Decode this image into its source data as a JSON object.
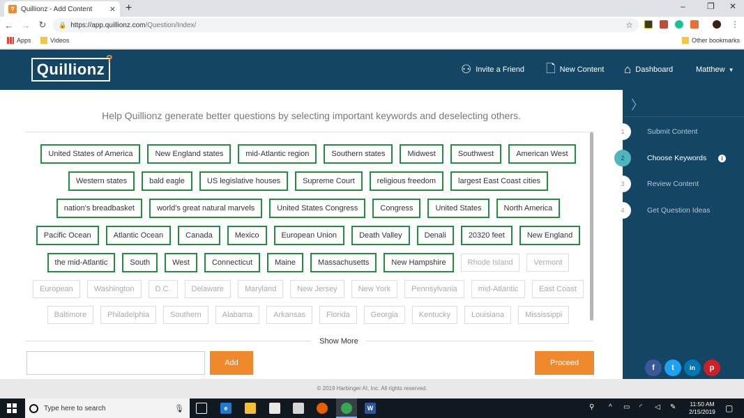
{
  "browser": {
    "tab_title": "Quillionz - Add Content",
    "tab_favicon": "?",
    "url_host": "https://app.quillionz.com",
    "url_path": "/Question/Index/",
    "bookmarks": [
      "Apps",
      "Videos"
    ],
    "other_bookmarks": "Other bookmarks"
  },
  "header": {
    "logo": "Quillionz",
    "logo_mark": "?",
    "invite": "Invite a Friend",
    "new_content": "New Content",
    "dashboard": "Dashboard",
    "user": "Matthew"
  },
  "main": {
    "instruction": "Help Quillionz generate better questions by selecting important keywords and deselecting others.",
    "show_more": "Show More",
    "add_label": "Add",
    "proceed_label": "Proceed"
  },
  "keywords": {
    "row1": [
      "United States of America",
      "New England states",
      "mid-Atlantic region",
      "Southern states",
      "Midwest",
      "Southwest",
      "American West"
    ],
    "row2": [
      "Western states",
      "bald eagle",
      "US legislative houses",
      "Supreme Court",
      "religious freedom",
      "largest East Coast cities"
    ],
    "row3": [
      "nation's breadbasket",
      "world's great natural marvels",
      "United States Congress",
      "Congress",
      "United States",
      "North America"
    ],
    "row4": [
      "Pacific Ocean",
      "Atlantic Ocean",
      "Canada",
      "Mexico",
      "European Union",
      "Death Valley",
      "Denali",
      "20320 feet",
      "New England"
    ],
    "row5_selected": [
      "the mid-Atlantic",
      "South",
      "West",
      "Connecticut",
      "Maine",
      "Massachusetts",
      "New Hampshire"
    ],
    "row5_unselected": [
      "Rhode Island",
      "Vermont"
    ],
    "row6": [
      "European",
      "Washington",
      "D.C.",
      "Delaware",
      "Maryland",
      "New Jersey",
      "New York",
      "Pennsylvania",
      "mid-Atlantic",
      "East Coast"
    ],
    "row7": [
      "Baltimore",
      "Philadelphia",
      "Southern",
      "Alabama",
      "Arkansas",
      "Florida",
      "Georgia",
      "Kentucky",
      "Louisiana",
      "Mississippi"
    ]
  },
  "sidebar": {
    "steps": [
      {
        "num": "1",
        "label": "Submit Content"
      },
      {
        "num": "2",
        "label": "Choose Keywords"
      },
      {
        "num": "3",
        "label": "Review Content"
      },
      {
        "num": "4",
        "label": "Get Question Ideas"
      }
    ],
    "active_step": 2,
    "social": [
      "f",
      "t",
      "in",
      "p"
    ]
  },
  "footer": "© 2019 Harbinger AI, Inc. All rights reserved.",
  "taskbar": {
    "search_placeholder": "Type here to search",
    "time": "11:50 AM",
    "date": "2/15/2019"
  },
  "colors": {
    "header_bg": "#134664",
    "accent": "#f0892b",
    "keyword_border": "#1f8f3e",
    "active_step": "#4fb6bd"
  }
}
